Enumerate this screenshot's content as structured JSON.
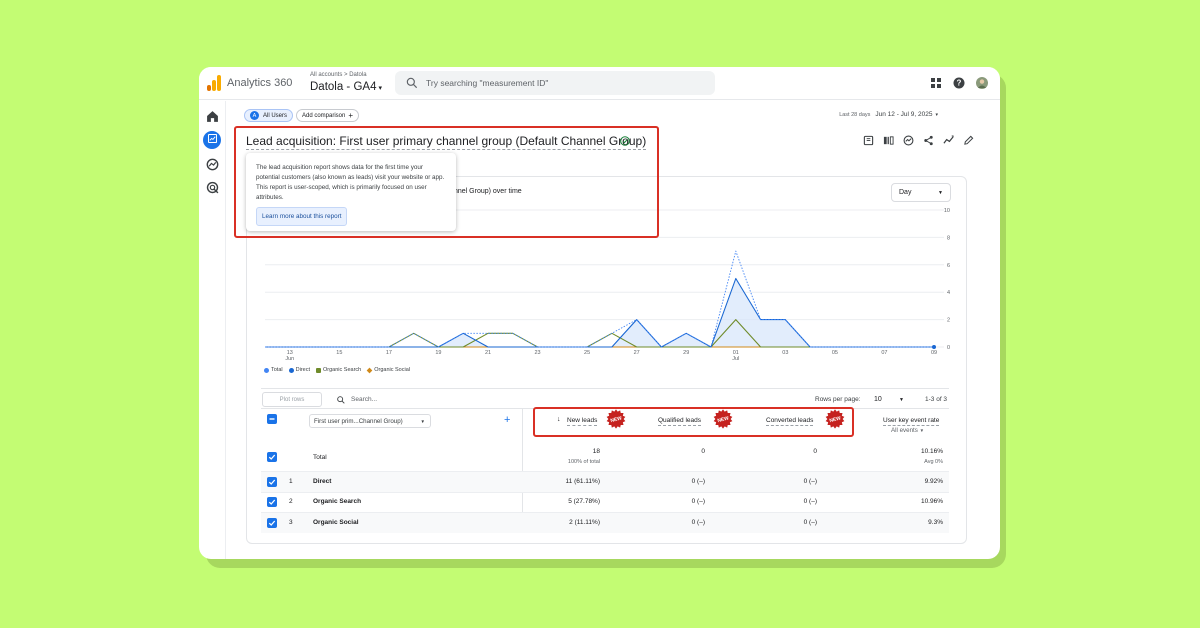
{
  "topbar": {
    "app_name": "Analytics 360",
    "breadcrumb": "All accounts > Datola",
    "property": "Datola - GA4",
    "search_placeholder": "Try searching \"measurement ID\""
  },
  "comparison": {
    "all_users_badge": "A",
    "all_users": "All Users",
    "add_comparison": "Add comparison"
  },
  "dates": {
    "preset": "Last 28 days",
    "range": "Jun 12 - Jul 9, 2025"
  },
  "report": {
    "title": "Lead acquisition: First user primary channel group (Default Channel Group)",
    "tooltip_text": "The lead acquisition report shows data for the first time your potential customers (also known as leads) visit your website or app. This report is user-scoped, which is primarily focused on user attributes.",
    "tooltip_link": "Learn more about this report"
  },
  "chart_card": {
    "title_fragment": "nnel Group) over time",
    "granularity": "Day"
  },
  "chart_data": {
    "type": "line",
    "x_labels": [
      "13\nJun",
      "15",
      "17",
      "19",
      "21",
      "23",
      "25",
      "27",
      "29",
      "01\nJul",
      "03",
      "05",
      "07",
      "09"
    ],
    "x_tick_days": [
      1,
      3,
      5,
      7,
      9,
      11,
      13,
      15,
      17,
      19,
      21,
      23,
      25,
      27
    ],
    "yticks": [
      0,
      2,
      4,
      6,
      8,
      10
    ],
    "ylim": [
      0,
      10
    ],
    "series": [
      {
        "name": "Total",
        "color": "#4285f4",
        "style": "dashed",
        "values": [
          0,
          0,
          0,
          0,
          0,
          0,
          1,
          0,
          1,
          1,
          1,
          0,
          0,
          0,
          1,
          2,
          0,
          1,
          0,
          7,
          2,
          2,
          0,
          0,
          0,
          0,
          0,
          0
        ]
      },
      {
        "name": "Direct",
        "color": "#1967d2",
        "style": "solid-area",
        "values": [
          0,
          0,
          0,
          0,
          0,
          0,
          0,
          0,
          1,
          0,
          0,
          0,
          0,
          0,
          0,
          2,
          0,
          1,
          0,
          5,
          2,
          2,
          0,
          0,
          0,
          0,
          0,
          0
        ]
      },
      {
        "name": "Organic Search",
        "color": "#6f8b2a",
        "style": "solid",
        "values": [
          0,
          0,
          0,
          0,
          0,
          0,
          1,
          0,
          0,
          1,
          1,
          0,
          0,
          0,
          1,
          0,
          0,
          0,
          0,
          2,
          0,
          0,
          0,
          0,
          0,
          0,
          0,
          0
        ]
      },
      {
        "name": "Organic Social",
        "color": "#d08a1a",
        "style": "solid",
        "values": [
          0,
          0,
          0,
          0,
          0,
          0,
          0,
          0,
          0,
          0,
          0,
          0,
          0,
          0,
          0,
          0,
          0,
          0,
          0,
          0,
          0,
          0,
          0,
          0,
          0,
          0,
          0,
          0
        ]
      }
    ]
  },
  "legend": [
    "Total",
    "Direct",
    "Organic Search",
    "Organic Social"
  ],
  "table_controls": {
    "plot_rows": "Plot rows",
    "search_placeholder": "Search...",
    "rows_per_page_label": "Rows per page:",
    "rows_per_page": "10",
    "range": "1-3 of 3"
  },
  "table": {
    "dimension": "First user prim...Channel Group)",
    "badge": "NEW",
    "headers": {
      "new_leads": "New leads",
      "qualified_leads": "Qualified leads",
      "converted_leads": "Converted leads",
      "event_rate": "User key event rate",
      "event_rate_sub": "All events"
    },
    "total": {
      "label": "Total",
      "new_leads": "18",
      "new_leads_sub": "100% of total",
      "qualified": "0",
      "converted": "0",
      "rate": "10.16%",
      "rate_sub": "Avg 0%"
    },
    "rows": [
      {
        "idx": "1",
        "name": "Direct",
        "new_leads": "11 (61.11%)",
        "qualified": "0 (–)",
        "converted": "0 (–)",
        "rate": "9.92%"
      },
      {
        "idx": "2",
        "name": "Organic Search",
        "new_leads": "5 (27.78%)",
        "qualified": "0 (–)",
        "converted": "0 (–)",
        "rate": "10.96%"
      },
      {
        "idx": "3",
        "name": "Organic Social",
        "new_leads": "2 (11.11%)",
        "qualified": "0 (–)",
        "converted": "0 (–)",
        "rate": "9.3%"
      }
    ]
  }
}
